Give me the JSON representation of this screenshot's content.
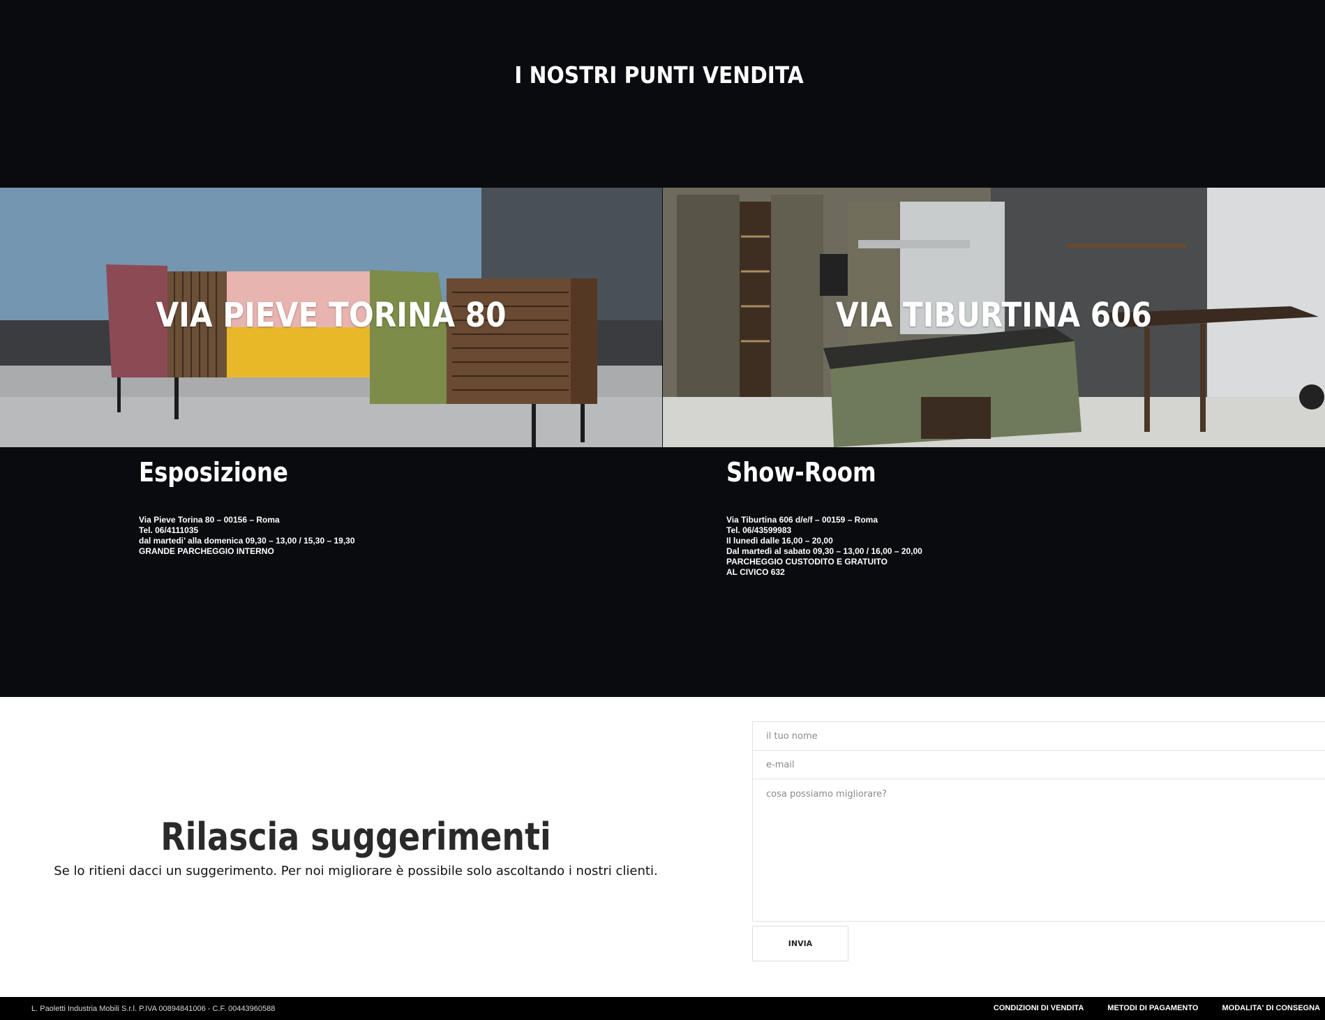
{
  "section": {
    "title": "I NOSTRI PUNTI VENDITA"
  },
  "stores": [
    {
      "image_title": "VIA PIEVE TORINA 80",
      "heading": "Esposizione",
      "lines": [
        "Via Pieve Torina 80 – 00156 – Roma",
        "Tel. 06/4111035",
        "dal martedi’ alla domenica 09,30 – 13,00 / 15,30 – 19,30",
        "GRANDE PARCHEGGIO INTERNO"
      ]
    },
    {
      "image_title": "VIA TIBURTINA 606",
      "heading": "Show-Room",
      "lines": [
        "Via Tiburtina 606 d/e/f – 00159 – Roma",
        "Tel. 06/43599983",
        "Il lunedì dalle 16,00 – 20,00",
        "Dal martedì al sabato 09,30 – 13,00 / 16,00 – 20,00",
        "PARCHEGGIO CUSTODITO E GRATUITO",
        "AL CIVICO 632"
      ]
    }
  ],
  "suggestions": {
    "title": "Rilascia suggerimenti",
    "subtitle": "Se lo ritieni  dacci un suggerimento. Per noi migliorare è possibile solo ascoltando i nostri clienti.",
    "name_placeholder": "il tuo nome",
    "email_placeholder": "e-mail",
    "message_placeholder": "cosa possiamo migliorare?",
    "submit_label": "INVIA"
  },
  "footer": {
    "legal": "L. Paoletti Industria Mobili S.r.l. P.IVA 00894841006 - C.F. 00443960588",
    "links": [
      "CONDIZIONI DI VENDITA",
      "METODI DI PAGAMENTO",
      "MODALITA' DI CONSEGNA"
    ]
  }
}
